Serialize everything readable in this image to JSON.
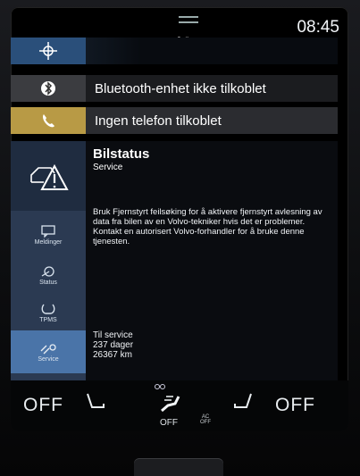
{
  "status_bar": {
    "time": "08:45"
  },
  "top_bars": [
    {
      "icon": "navigation-compass-icon",
      "label": ""
    },
    {
      "icon": "bluetooth-icon",
      "label": "Bluetooth-enhet ikke tilkoblet"
    },
    {
      "icon": "phone-icon",
      "label": "Ingen telefon tilkoblet"
    }
  ],
  "car_status": {
    "title": "Bilstatus",
    "subtitle": "Service",
    "body": "Bruk Fjernstyrt feilsøking for å aktivere fjernstyrt avlesning av data fra bilen av en Volvo-tekniker hvis det er problemer. Kontakt en autorisert Volvo-forhandler for å bruke denne tjenesten.",
    "service_label": "Til service",
    "service_days": "237 dager",
    "service_km": "26367 km",
    "sidebar": [
      {
        "icon": "messages-icon",
        "label": "Meldinger"
      },
      {
        "icon": "status-icon",
        "label": "Status"
      },
      {
        "icon": "tpms-icon",
        "label": "TPMS"
      },
      {
        "icon": "service-icon",
        "label": "Service",
        "selected": true
      }
    ]
  },
  "climate": {
    "left_temp": "OFF",
    "right_temp": "OFF",
    "fan_label": "OFF",
    "ac_label": "AC",
    "ac_sub": "OFF"
  }
}
